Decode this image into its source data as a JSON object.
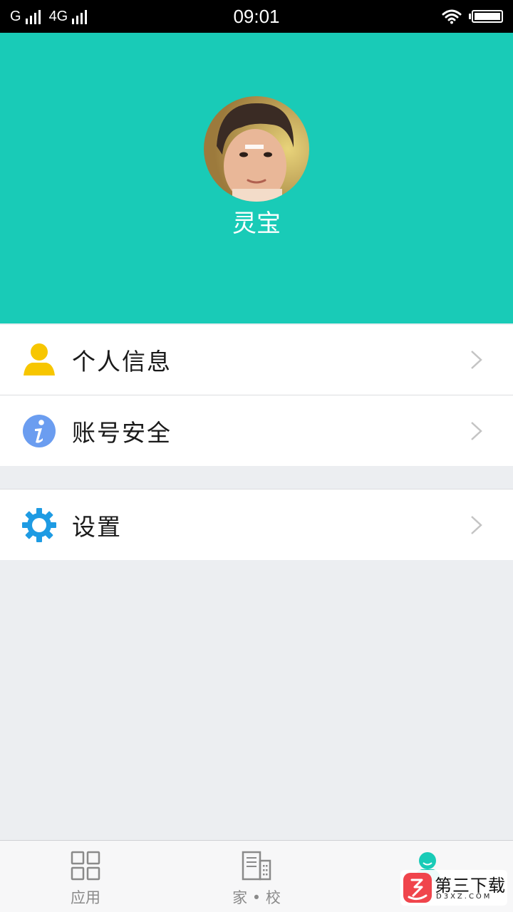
{
  "status_bar": {
    "carrier1": "G",
    "carrier2": "4G",
    "time": "09:01",
    "icons": [
      "signal-icon",
      "signal-icon",
      "wifi-icon",
      "battery-icon"
    ]
  },
  "profile": {
    "name": "灵宝",
    "avatar_icon": "avatar-photo",
    "header_color": "#19cbb7"
  },
  "menu": {
    "group1": [
      {
        "label": "个人信息",
        "icon": "person-icon",
        "icon_color": "#f7c600"
      },
      {
        "label": "账号安全",
        "icon": "info-icon",
        "icon_color": "#6b9df0"
      }
    ],
    "group2": [
      {
        "label": "设置",
        "icon": "gear-icon",
        "icon_color": "#1e9be3"
      }
    ]
  },
  "bottom_nav": {
    "items": [
      {
        "label": "应用",
        "icon": "apps-grid-icon",
        "active": false
      },
      {
        "label": "家 • 校",
        "icon": "building-icon",
        "active": false
      },
      {
        "label": "",
        "icon": "person-icon",
        "active": true
      }
    ],
    "active_color": "#19cbb7"
  },
  "watermark": {
    "title": "第三下载",
    "sub": "D3XZ.COM"
  }
}
